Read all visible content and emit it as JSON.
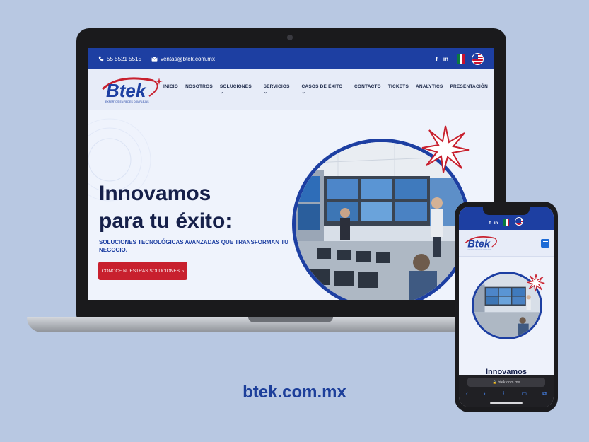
{
  "site": {
    "topbar": {
      "phone": "55 5521 5515",
      "email": "ventas@btek.com.mx",
      "social": [
        "f",
        "in"
      ],
      "icons": [
        "phone-icon",
        "mail-icon",
        "facebook-icon",
        "linkedin-icon",
        "flag-mexico-icon",
        "flag-usa-icon"
      ]
    },
    "logo": {
      "text": "Btek",
      "tagline": "EXPERTOS EN REDES COMPLEJAS"
    },
    "nav": {
      "items": [
        "INICIO",
        "NOSOTROS",
        "SOLUCIONES",
        "SERVICIOS",
        "CASOS DE ÉXITO",
        "CONTACTO",
        "TICKETS",
        "ANALYTICS",
        "PRESENTACIÓN"
      ],
      "dropdown_marker": "⌄"
    },
    "hero": {
      "title_line1": "Innovamos",
      "title_line2": "para tu éxito:",
      "subtitle": "SOLUCIONES TECNOLÓGICAS AVANZADAS QUE TRANSFORMAN TU NEGOCIO.",
      "cta_label": "CONOCE NUESTRAS SOLUCIONES",
      "cta_arrow": "›"
    }
  },
  "phone": {
    "hero_title": "Innovamos",
    "url": "btek.com.mx",
    "url_lock": "🔒",
    "toolbar": [
      "‹",
      "›",
      "⇪",
      "▭",
      "⧉"
    ]
  },
  "caption": "btek.com.mx",
  "colors": {
    "brand_blue": "#1d3fa2",
    "brand_red": "#c8202e",
    "background": "#b8c8e2",
    "hero_bg": "#eff3fc",
    "dark_text": "#16204a"
  }
}
